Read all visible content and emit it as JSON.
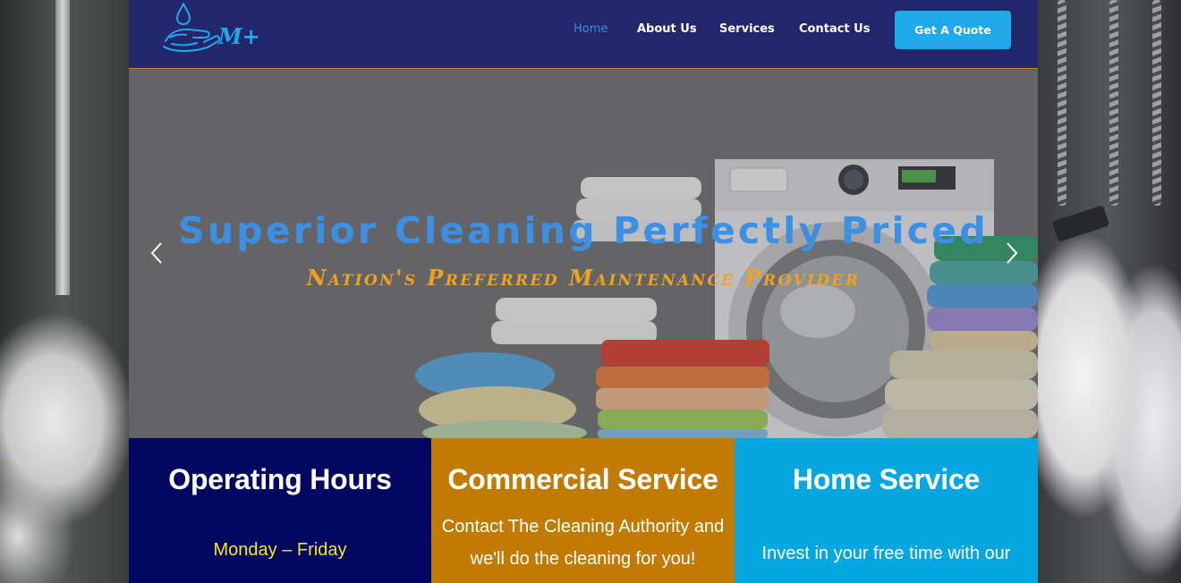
{
  "brand": {
    "logo_text": "M+",
    "colors": {
      "header_bg": "#22266b",
      "accent_blue": "#1fa9ea",
      "title_blue": "#3d8fe3",
      "subtitle_orange": "#f0a21e"
    }
  },
  "nav": {
    "items": [
      {
        "label": "Home",
        "active": true
      },
      {
        "label": "About Us",
        "active": false
      },
      {
        "label": "Services",
        "active": false
      },
      {
        "label": "Contact Us",
        "active": false
      }
    ],
    "cta_label": "Get A Quote"
  },
  "hero": {
    "title": "Superior Cleaning Perfectly Priced",
    "subtitle": "Nation's Preferred Maintenance Provider",
    "prev_icon": "chevron-left-icon",
    "next_icon": "chevron-right-icon"
  },
  "cards": {
    "hours": {
      "title": "Operating Hours",
      "line1": "Monday – Friday",
      "bg": "#010660",
      "text_color": "#f4e62b"
    },
    "commercial": {
      "title": "Commercial Service",
      "text": "Contact The Cleaning Authority and we'll do the cleaning for you!",
      "bg": "#c17b03"
    },
    "home": {
      "title": "Home Service",
      "text": "Invest in your free time with our",
      "bg": "#06a6e0"
    }
  }
}
